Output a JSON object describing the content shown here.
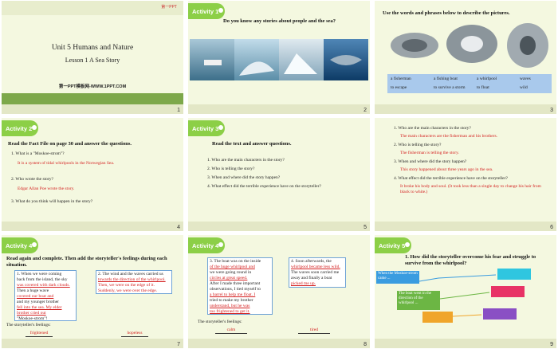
{
  "slide1": {
    "logo": "第一PPT",
    "title": "Unit 5 Humans and Nature",
    "subtitle": "Lesson 1 A Sea Story",
    "footer": "第一PPT模板网-WWW.1PPT.COM",
    "num": "1"
  },
  "slide2": {
    "badge": "Activity 1",
    "question": "Do you know any stories about people and the sea?",
    "num": "2"
  },
  "slide3": {
    "heading": "Use the words and phrases below to describe the pictures.",
    "words": [
      "a fisherman",
      "a fishing boat",
      "a whirlpool",
      "waves",
      "to escape",
      "to survive a storm",
      "to float",
      "wild"
    ],
    "num": "3"
  },
  "slide4": {
    "badge": "Activity 2",
    "heading": "Read the Fact File on page 30 and answer the questions.",
    "q1": "1.  What is a \"Moskoe-strom\"?",
    "a1": "It is a system of tidal whirlpools in the Norwegian Sea.",
    "q2": "2.  Who wrote the story?",
    "a2": "Edgar Allan Poe wrote the story.",
    "q3": "3.  What do you think will happen in the story?",
    "num": "4"
  },
  "slide5": {
    "badge": "Activity 3",
    "heading": "Read the text and answer questions.",
    "q1": "1. Who are the main characters  in the story?",
    "q2": "2. Who is telling the story?",
    "q3": "3. When and where did the story happen?",
    "q4": "4. What effect  did the terrible experience  have on the storyteller?",
    "num": "5"
  },
  "slide6": {
    "q1": "1.  Who are the main characters  in the story?",
    "a1": "The main characters  are the fisherman  and his brothers.",
    "q2": "2. Who is telling the story?",
    "a2": "The fisherman  is telling the story.",
    "q3": "3. When and where did the story happen?",
    "a3": "This story happened about three years ago in the sea.",
    "q4": "4. What effect  did the terrible experience  have on the storyteller?",
    "a4": "It broke his body and soul. (It took less than a single day to change his hair from black to white.)",
    "num": "6"
  },
  "slide7": {
    "badge": "Activity 4",
    "heading": "Read again and complete. Then add the storyteller's feelings during each situation.",
    "box1": [
      "1. When we were coming",
      "back from the island, the sky",
      "was covered with dark clouds.",
      "Then a huge wave",
      "covered our boat and",
      "and my younger brother",
      "fell into the sea. My elder",
      "brother cried out",
      "\"Moskoe-strom\"!"
    ],
    "box2": [
      "2. The wind and the waves carried us",
      "towards the direction of the whirlpool.",
      "Then, we were on the edge of it.",
      "Suddenly, we were over the edge."
    ],
    "feel_label": "The storyteller's feelings:",
    "f1": "frightened",
    "f2": "hopeless",
    "num": "7"
  },
  "slide8": {
    "badge": "Activity 4",
    "box3": [
      "3. The boat was on the inside",
      "of the huge whirlpool and",
      "we were going round in",
      "circles at great speed.",
      "After I made three important",
      "observations, I tied myself to",
      "a barrel to help me float. I",
      "tried to make my brother",
      "understand, but he was",
      "too frightened to get it."
    ],
    "box4": [
      "4. Soon afterwards, the",
      "whirlpool became less wild.",
      "The waves soon carried me",
      "away and finally a boat",
      "picked me up."
    ],
    "feel_label": "The storyteller's feelings:",
    "f1": "calm",
    "f2": "tired",
    "num": "8"
  },
  "slide9": {
    "badge": "Activity 5",
    "heading": "1. How did the storyteller overcome his fear and struggle to survive from the whirlpool?",
    "b1": "When the Moskoe-strom came ...",
    "b2": "The boat went in the direction of the whirlpool ...",
    "num": "9"
  }
}
